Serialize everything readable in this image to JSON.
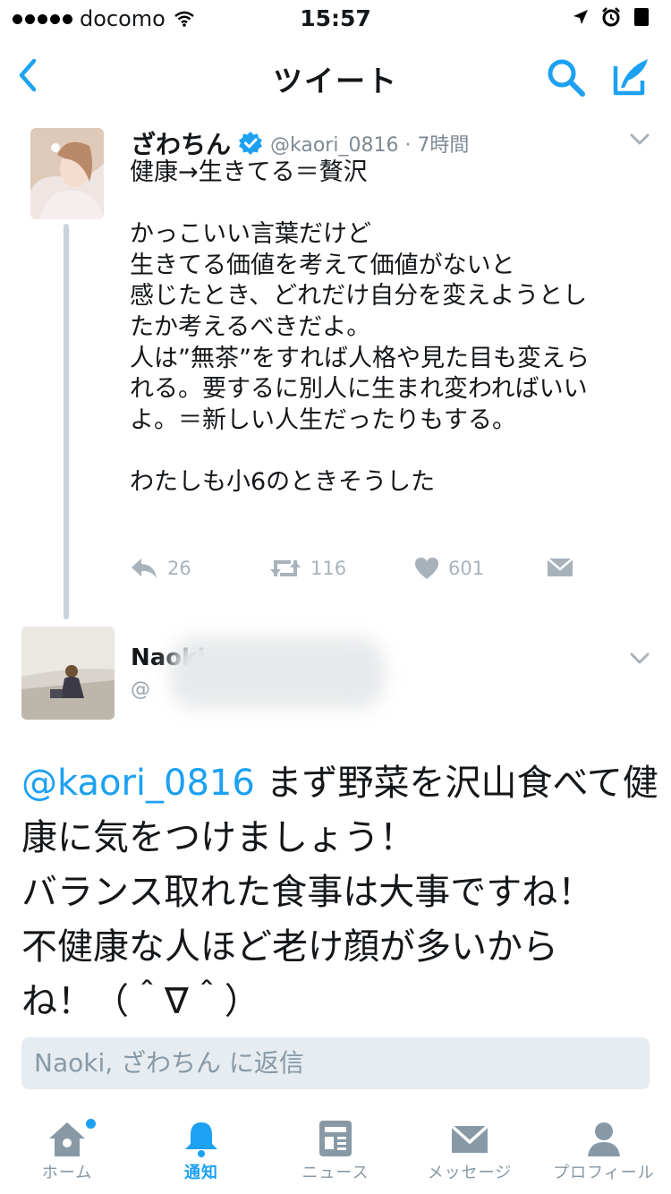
{
  "status_bar": {
    "carrier": "docomo",
    "time": "15:57"
  },
  "nav": {
    "title": "ツイート"
  },
  "tweet1": {
    "name": "ざわちん",
    "handle_time": "@kaori_0816 · 7時間",
    "lines": [
      "健康→生きてる＝贅沢",
      "",
      "かっこいい言葉だけど",
      "生きてる価値を考えて価値がないと",
      "感じたとき、どれだけ自分を変えようとし",
      "たか考えるべきだよ。",
      "人は”無茶”をすれば人格や見た目も変えら",
      "れる。要するに別人に生まれ変わればいい",
      "よ。＝新しい人生だったりもする。",
      "",
      "わたしも小6のときそうした"
    ],
    "reply_count": "26",
    "retweet_count": "116",
    "like_count": "601"
  },
  "tweet2": {
    "name": "Naoki",
    "handle": "@",
    "mention": "@kaori_0816",
    "line1_rest": " まず野菜を沢山食べて健",
    "lines": [
      "康に気をつけましょう！",
      "バランス取れた食事は大事ですね！",
      "不健康な人ほど老け顔が多いから",
      "ね！（＾∇＾）"
    ]
  },
  "reply_box": {
    "placeholder": "Naoki, ざわちん に返信"
  },
  "tab_bar": {
    "home": "ホーム",
    "notifications": "通知",
    "news": "ニュース",
    "messages": "メッセージ",
    "profile": "プロフィール"
  },
  "colors": {
    "accent": "#1da1f2",
    "muted": "#8899a6",
    "thread_line": "#c9d3dc"
  }
}
